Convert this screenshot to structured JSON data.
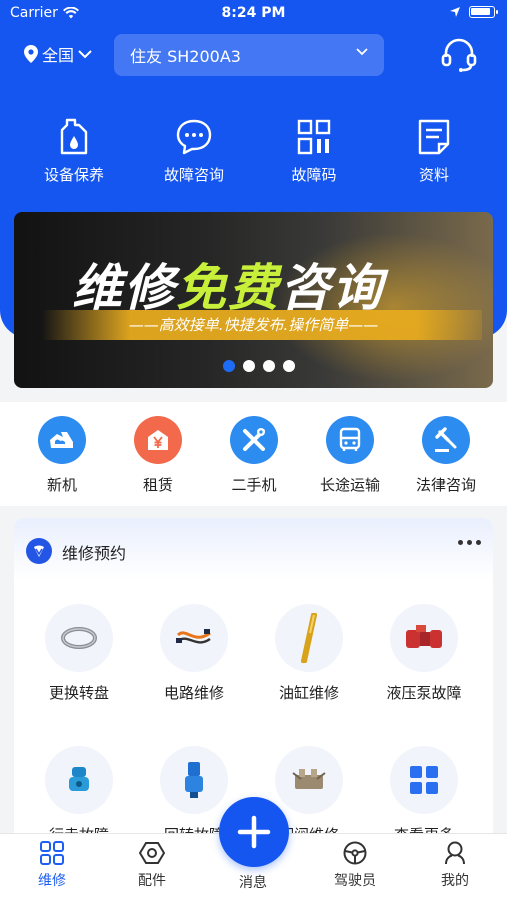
{
  "status_bar": {
    "carrier": "Carrier",
    "time": "8:24 PM"
  },
  "header": {
    "region": "全国",
    "machine": "住友 SH200A3"
  },
  "quick_actions": [
    {
      "label": "设备保养",
      "icon": "oil-bottle-icon"
    },
    {
      "label": "故障咨询",
      "icon": "chat-bubble-icon"
    },
    {
      "label": "故障码",
      "icon": "code-grid-icon"
    },
    {
      "label": "资料",
      "icon": "document-icon"
    }
  ],
  "banner": {
    "title_part1": "维修",
    "title_part2": "免费",
    "title_part3": "咨询",
    "subtitle": "——高效接单.快捷发布.操作简单——",
    "active_dot": 1,
    "dot_count": 4
  },
  "services": [
    {
      "label": "新机",
      "color": "#2d8cf0",
      "icon": "excavator-icon"
    },
    {
      "label": "租赁",
      "color": "#f26a4b",
      "icon": "yen-house-icon"
    },
    {
      "label": "二手机",
      "color": "#2d8cf0",
      "icon": "tools-icon"
    },
    {
      "label": "长途运输",
      "color": "#2d8cf0",
      "icon": "bus-icon"
    },
    {
      "label": "法律咨询",
      "color": "#2d8cf0",
      "icon": "gavel-icon"
    }
  ],
  "repair_card": {
    "title": "维修预约",
    "items": [
      {
        "label": "更换转盘",
        "icon": "slewing-ring-icon"
      },
      {
        "label": "电路维修",
        "icon": "wiring-harness-icon"
      },
      {
        "label": "油缸维修",
        "icon": "hydraulic-cylinder-icon"
      },
      {
        "label": "液压泵故障",
        "icon": "hydraulic-pump-icon"
      },
      {
        "label": "行走故障",
        "icon": "travel-motor-icon"
      },
      {
        "label": "回转故障",
        "icon": "swing-motor-icon"
      },
      {
        "label": "配阀维修",
        "icon": "control-valve-icon"
      },
      {
        "label": "查看更多",
        "icon": "grid-more-icon"
      }
    ]
  },
  "tabbar": [
    {
      "label": "维修",
      "active": true
    },
    {
      "label": "配件",
      "active": false
    },
    {
      "label": "消息",
      "active": false
    },
    {
      "label": "驾驶员",
      "active": false
    },
    {
      "label": "我的",
      "active": false
    }
  ],
  "colors": {
    "primary": "#1556f0",
    "accent_yellow": "#c8f03a",
    "rental_orange": "#f26a4b"
  }
}
